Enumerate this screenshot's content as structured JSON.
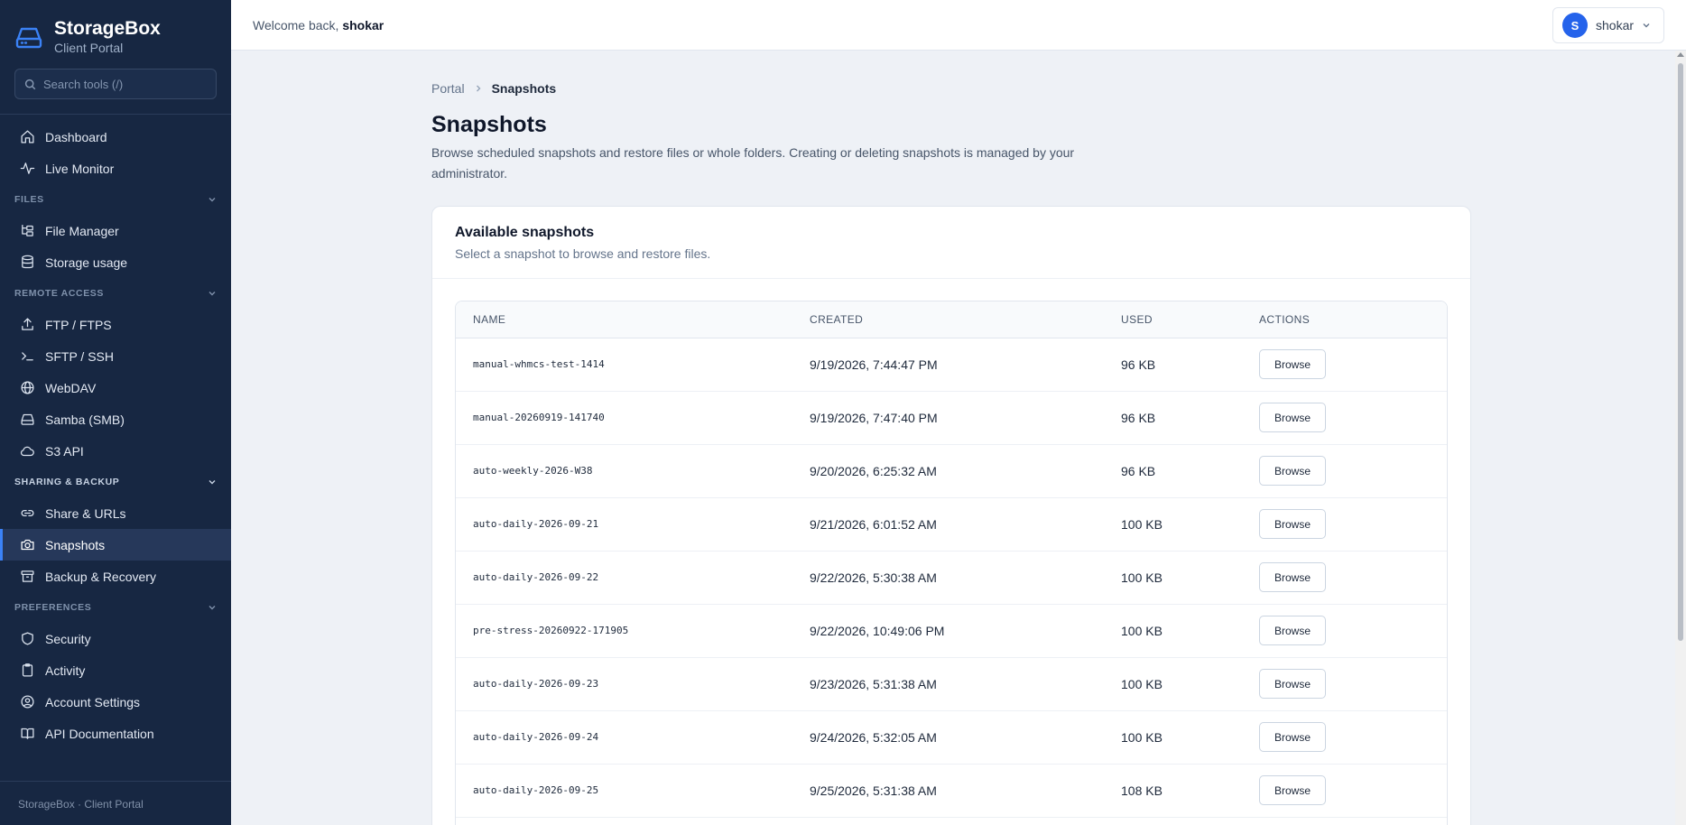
{
  "brand": {
    "title": "StorageBox",
    "subtitle": "Client Portal"
  },
  "search": {
    "placeholder": "Search tools (/)"
  },
  "nav": {
    "top": [
      {
        "label": "Dashboard",
        "icon": "home-icon"
      },
      {
        "label": "Live Monitor",
        "icon": "activity-icon"
      }
    ],
    "sections": [
      {
        "title": "FILES",
        "items": [
          {
            "label": "File Manager",
            "icon": "folder-tree-icon"
          },
          {
            "label": "Storage usage",
            "icon": "database-icon"
          }
        ]
      },
      {
        "title": "REMOTE ACCESS",
        "items": [
          {
            "label": "FTP / FTPS",
            "icon": "upload-icon"
          },
          {
            "label": "SFTP / SSH",
            "icon": "terminal-icon"
          },
          {
            "label": "WebDAV",
            "icon": "globe-icon"
          },
          {
            "label": "Samba (SMB)",
            "icon": "drive-icon"
          },
          {
            "label": "S3 API",
            "icon": "cloud-icon"
          }
        ]
      },
      {
        "title": "SHARING & BACKUP",
        "items": [
          {
            "label": "Share & URLs",
            "icon": "link-icon"
          },
          {
            "label": "Snapshots",
            "icon": "camera-icon",
            "active": true
          },
          {
            "label": "Backup & Recovery",
            "icon": "archive-icon"
          }
        ]
      },
      {
        "title": "PREFERENCES",
        "items": [
          {
            "label": "Security",
            "icon": "shield-icon"
          },
          {
            "label": "Activity",
            "icon": "clipboard-icon"
          },
          {
            "label": "Account Settings",
            "icon": "user-circle-icon"
          },
          {
            "label": "API Documentation",
            "icon": "book-icon"
          }
        ]
      }
    ]
  },
  "footer": {
    "text": "StorageBox · Client Portal"
  },
  "topbar": {
    "welcome_prefix": "Welcome back, ",
    "username": "shokar",
    "avatar_initial": "S"
  },
  "breadcrumb": {
    "parent": "Portal",
    "current": "Snapshots"
  },
  "page": {
    "title": "Snapshots",
    "description": "Browse scheduled snapshots and restore files or whole folders. Creating or deleting snapshots is managed by your administrator."
  },
  "card": {
    "title": "Available snapshots",
    "subtitle": "Select a snapshot to browse and restore files.",
    "table": {
      "headers": [
        "NAME",
        "CREATED",
        "USED",
        "ACTIONS"
      ],
      "action_label": "Browse",
      "rows": [
        {
          "name": "manual-whmcs-test-1414",
          "created": "9/19/2026, 7:44:47 PM",
          "used": "96 KB"
        },
        {
          "name": "manual-20260919-141740",
          "created": "9/19/2026, 7:47:40 PM",
          "used": "96 KB"
        },
        {
          "name": "auto-weekly-2026-W38",
          "created": "9/20/2026, 6:25:32 AM",
          "used": "96 KB"
        },
        {
          "name": "auto-daily-2026-09-21",
          "created": "9/21/2026, 6:01:52 AM",
          "used": "100 KB"
        },
        {
          "name": "auto-daily-2026-09-22",
          "created": "9/22/2026, 5:30:38 AM",
          "used": "100 KB"
        },
        {
          "name": "pre-stress-20260922-171905",
          "created": "9/22/2026, 10:49:06 PM",
          "used": "100 KB"
        },
        {
          "name": "auto-daily-2026-09-23",
          "created": "9/23/2026, 5:31:38 AM",
          "used": "100 KB"
        },
        {
          "name": "auto-daily-2026-09-24",
          "created": "9/24/2026, 5:32:05 AM",
          "used": "100 KB"
        },
        {
          "name": "auto-daily-2026-09-25",
          "created": "9/25/2026, 5:31:38 AM",
          "used": "108 KB"
        }
      ]
    }
  },
  "colors": {
    "sidebar_bg": "#172742",
    "accent": "#3b82f6",
    "avatar": "#2563eb",
    "page_bg": "#eef1f6"
  }
}
